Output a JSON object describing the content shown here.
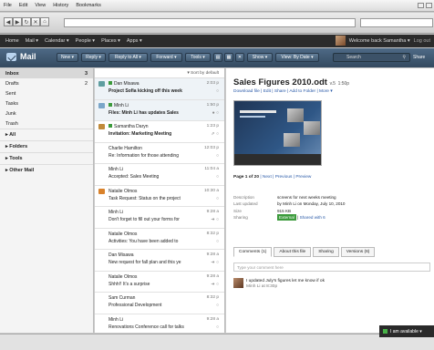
{
  "menubar": [
    "File",
    "Edit",
    "View",
    "History",
    "Bookmarks"
  ],
  "nav": {
    "back": "◀",
    "forward": "▶",
    "reload": "↻",
    "stop": "✕",
    "home": "⌂"
  },
  "appnav": {
    "items": [
      "Home",
      "Mail ▾",
      "Calendar ▾",
      "People ▾",
      "Places ▾",
      "Apps ▾"
    ],
    "welcome": "Welcome back Samantha ▾",
    "logout": "Log out"
  },
  "toolbar": {
    "title": "Mail",
    "buttons": [
      "New ▾",
      "Reply ▾",
      "Reply to All ▾",
      "Forward ▾",
      "Tools ▾",
      "Show ▾",
      "View: By Date ▾"
    ],
    "search": "Search",
    "share": "Share"
  },
  "sidebar": {
    "items": [
      {
        "label": "Inbox",
        "count": "3"
      },
      {
        "label": "Drafts",
        "count": "2"
      },
      {
        "label": "Sent",
        "count": ""
      },
      {
        "label": "Tasks",
        "count": ""
      },
      {
        "label": "Junk",
        "count": ""
      },
      {
        "label": "Trash",
        "count": ""
      }
    ],
    "sections": [
      "▸ All",
      "▸ Folders",
      "▸ Tools",
      "▸ Other Mail"
    ]
  },
  "list": {
    "sort": "▾ Sort by default",
    "messages": [
      {
        "from": "Dan Misawa",
        "subject": "Project Sofia kicking off this week",
        "time": "2:03 p",
        "ind": "○",
        "unread": true,
        "bold": true
      },
      {
        "from": "Minh Li",
        "subject": "Files: Minh Li has updates Sales",
        "time": "1:50 p",
        "ind": "● ○",
        "unread": true,
        "bold": true
      },
      {
        "from": "Samantha Daryn",
        "subject": "Invitation: Marketing Meeting",
        "time": "1:23 p",
        "ind": "⇗ ○",
        "unread": false,
        "bold": true
      },
      {
        "from": "Charlie Hamilton",
        "subject": "Re: Information for those attending",
        "time": "12:03 p",
        "ind": "○",
        "unread": false,
        "bold": false
      },
      {
        "from": "Minh Li",
        "subject": "Accepted: Sales Meeting",
        "time": "11:04 a",
        "ind": "○",
        "unread": false,
        "bold": false
      },
      {
        "from": "Natalie Olmos",
        "subject": "Task Request: Status on the project",
        "time": "10:30 a",
        "ind": "○",
        "unread": false,
        "bold": false
      },
      {
        "from": "Minh Li",
        "subject": "Don't forget to fill out your forms for",
        "time": "9:28 a",
        "ind": "➜ ○",
        "unread": false,
        "bold": false
      },
      {
        "from": "Natalie Olmos",
        "subject": "Activities: You have been added to",
        "time": "8:32 p",
        "ind": "○",
        "unread": false,
        "bold": false
      },
      {
        "from": "Dan Misawa",
        "subject": "New request for fall plan and this ye",
        "time": "9:28 a",
        "ind": "➜ ○",
        "unread": false,
        "bold": false
      },
      {
        "from": "Natalie Olmos",
        "subject": "Shhh!! It's a surprise",
        "time": "9:28 a",
        "ind": "➜ ○",
        "unread": false,
        "bold": false
      },
      {
        "from": "Sam Curman",
        "subject": "Professional Development",
        "time": "8:32 p",
        "ind": "○",
        "unread": false,
        "bold": false
      },
      {
        "from": "Minh Li",
        "subject": "Renovations Conference call for talks",
        "time": "9:28 a",
        "ind": "○",
        "unread": false,
        "bold": false
      }
    ]
  },
  "preview": {
    "title": "Sales Figures 2010.odt",
    "version": "v.5",
    "time": "1:50p",
    "links": "Download file | Edit | Share | Add to Folder | More ▾",
    "pager": {
      "page": "Page 1 of 20",
      "next": "Next",
      "prev": "Previous",
      "preview": "Preview"
    },
    "meta": [
      {
        "k": "Description",
        "v": "screens for next weeks meeting"
      },
      {
        "k": "Last updated",
        "v": "by Minh Li on Monday, July 10, 2010"
      },
      {
        "k": "Size",
        "v": "915 KB"
      }
    ],
    "sharing": {
      "k": "Sharing",
      "badge": "External",
      "v": "Shared with 6"
    },
    "tabs": [
      "Comments (1)",
      "About this file",
      "Sharing",
      "Versions (6)"
    ],
    "comment_placeholder": "Type your comment here",
    "comment": {
      "text": "I updated July's figures let me know if ok",
      "by": "Minh Li at 8:30p"
    }
  },
  "status": {
    "available": "I am available ▾"
  }
}
